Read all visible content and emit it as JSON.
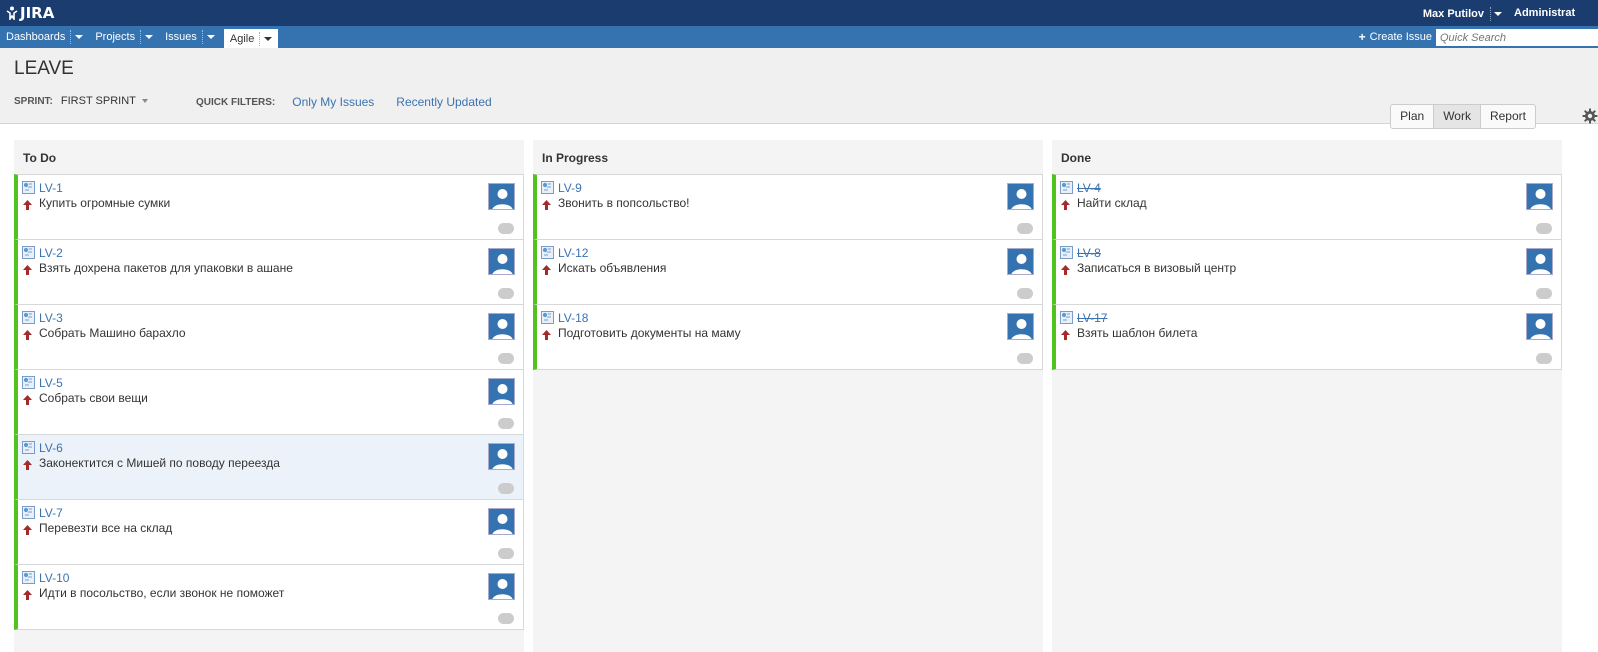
{
  "header": {
    "logo_text": "JIRA",
    "user_name": "Max Putilov",
    "admin_label": "Administrat"
  },
  "nav": {
    "items": [
      {
        "label": "Dashboards"
      },
      {
        "label": "Projects"
      },
      {
        "label": "Issues"
      },
      {
        "label": "Agile"
      }
    ],
    "create_label": "Create Issue",
    "search_placeholder": "Quick Search"
  },
  "board": {
    "title": "LEAVE",
    "sprint_label": "SPRINT:",
    "sprint_value": "FIRST SPRINT",
    "quick_filters_label": "QUICK FILTERS:",
    "quick_filters": [
      "Only My Issues",
      "Recently Updated"
    ],
    "modes": [
      "Plan",
      "Work",
      "Report"
    ],
    "active_mode": "Work"
  },
  "colors": {
    "topbar": "#1a3c6e",
    "navbar": "#3572b0",
    "card_accent": "#51c31e",
    "link": "#3b73af"
  },
  "columns": [
    {
      "title": "To Do",
      "cards": [
        {
          "key": "LV-1",
          "summary": "Купить огромные сумки"
        },
        {
          "key": "LV-2",
          "summary": "Взять дохрена пакетов для упаковки в ашане"
        },
        {
          "key": "LV-3",
          "summary": "Собрать Машино барахло"
        },
        {
          "key": "LV-5",
          "summary": "Собрать свои вещи"
        },
        {
          "key": "LV-6",
          "summary": "Законектится с Мишей по поводу переезда"
        },
        {
          "key": "LV-7",
          "summary": "Перевезти все на склад"
        },
        {
          "key": "LV-10",
          "summary": "Идти в посольство, если звонок не поможет"
        }
      ]
    },
    {
      "title": "In Progress",
      "cards": [
        {
          "key": "LV-9",
          "summary": "Звонить в попсольство!"
        },
        {
          "key": "LV-12",
          "summary": "Искать объявления"
        },
        {
          "key": "LV-18",
          "summary": "Подготовить документы на маму"
        }
      ]
    },
    {
      "title": "Done",
      "cards": [
        {
          "key": "LV-4",
          "summary": "Найти склад"
        },
        {
          "key": "LV-8",
          "summary": "Записаться в визовый центр"
        },
        {
          "key": "LV-17",
          "summary": "Взять шаблон билета"
        }
      ]
    }
  ]
}
